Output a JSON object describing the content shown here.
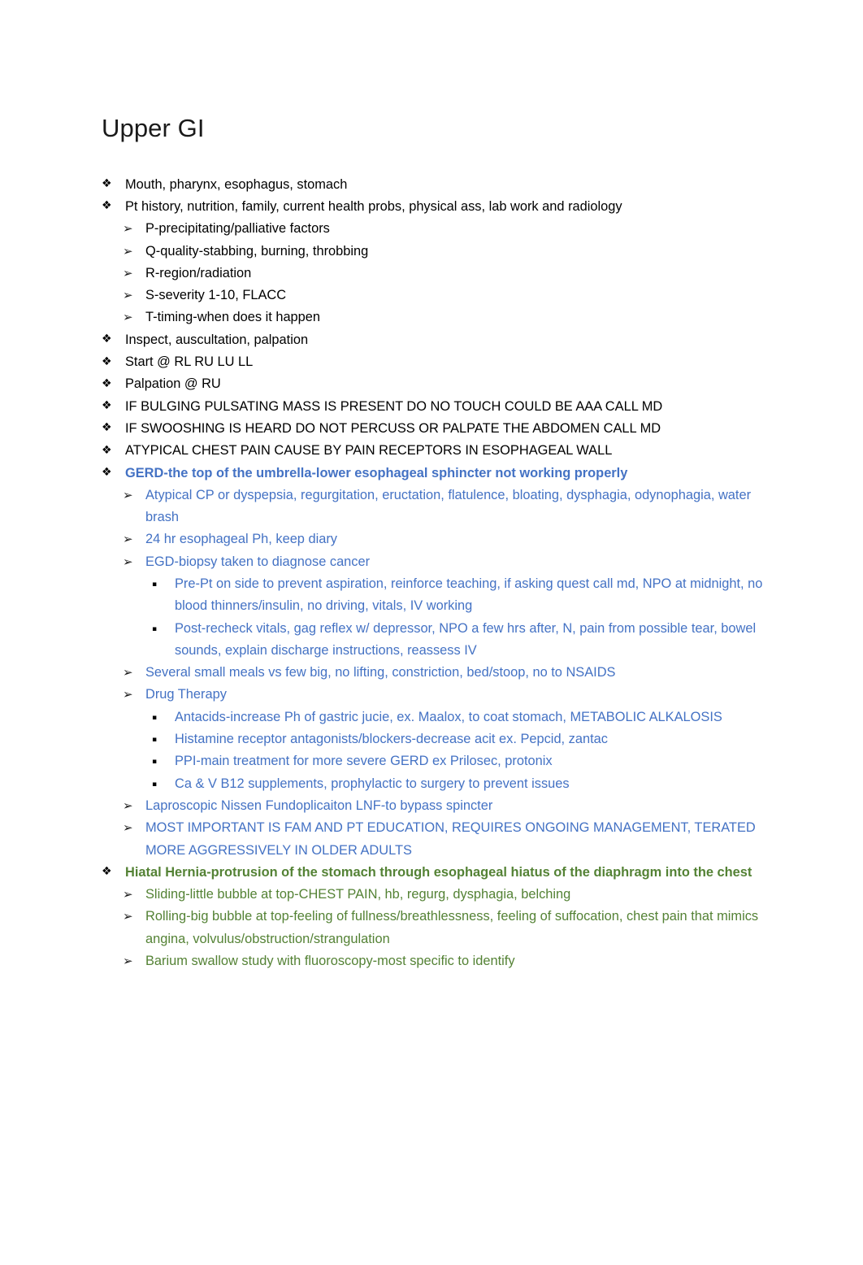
{
  "document": {
    "title": "Upper GI",
    "colors": {
      "text_black": "#000000",
      "accent_blue": "#4472C4",
      "accent_green": "#548235",
      "background": "#ffffff"
    },
    "bullets": {
      "level1": "❖",
      "level2": "➢",
      "level3": "▪"
    }
  },
  "outline": {
    "items": [
      {
        "text": "Mouth, pharynx, esophagus, stomach"
      },
      {
        "text": "Pt history, nutrition, family, current health probs, physical ass, lab work and radiology"
      },
      {
        "text": "P-precipitating/palliative factors"
      },
      {
        "text": "Q-quality-stabbing, burning, throbbing"
      },
      {
        "text": "R-region/radiation"
      },
      {
        "text": "S-severity 1-10, FLACC"
      },
      {
        "text": "T-timing-when does it happen"
      },
      {
        "text": "Inspect, auscultation, palpation"
      },
      {
        "text": "Start @ RL RU LU LL"
      },
      {
        "text": "Palpation @ RU"
      },
      {
        "text": "IF BULGING PULSATING MASS IS PRESENT DO NO TOUCH COULD BE AAA CALL MD"
      },
      {
        "text": "IF SWOOSHING IS HEARD DO NOT PERCUSS OR PALPATE THE ABDOMEN CALL MD"
      },
      {
        "text": "ATYPICAL CHEST PAIN CAUSE BY PAIN RECEPTORS IN ESOPHAGEAL WALL"
      },
      {
        "text": "GERD-the top of the umbrella-lower esophageal sphincter not working properly"
      },
      {
        "text": "Atypical CP or dyspepsia, regurgitation, eructation, flatulence, bloating, dysphagia, odynophagia, water brash"
      },
      {
        "text": "24 hr esophageal Ph, keep diary"
      },
      {
        "text": "EGD-biopsy taken to diagnose cancer"
      },
      {
        "text": "Pre-Pt on side to prevent aspiration, reinforce teaching, if asking quest call md, NPO at midnight, no blood thinners/insulin, no driving, vitals, IV working"
      },
      {
        "text": "Post-recheck vitals, gag reflex w/ depressor, NPO a few hrs after, N, pain from possible tear, bowel sounds, explain discharge instructions, reassess IV"
      },
      {
        "text": "Several small meals vs few big, no lifting, constriction, bed/stoop, no to NSAIDS"
      },
      {
        "text": "Drug Therapy"
      },
      {
        "text": "Antacids-increase Ph of gastric jucie, ex. Maalox, to coat stomach, METABOLIC ALKALOSIS"
      },
      {
        "text": "Histamine receptor antagonists/blockers-decrease acit ex. Pepcid, zantac"
      },
      {
        "text": "PPI-main treatment for more severe GERD ex Prilosec, protonix"
      },
      {
        "text": "Ca & V B12 supplements, prophylactic to surgery to prevent issues"
      },
      {
        "text": "Laproscopic Nissen Fundoplicaiton LNF-to bypass spincter"
      },
      {
        "text": "MOST IMPORTANT IS FAM AND PT EDUCATION, REQUIRES ONGOING MANAGEMENT, TERATED MORE AGGRESSIVELY IN OLDER ADULTS"
      },
      {
        "text": "Hiatal Hernia-protrusion of the stomach through esophageal hiatus of the diaphragm into the chest"
      },
      {
        "text": "Sliding-little bubble at top-CHEST PAIN, hb, regurg, dysphagia, belching"
      },
      {
        "text": "Rolling-big bubble at top-feeling of fullness/breathlessness, feeling of suffocation, chest pain that mimics angina, volvulus/obstruction/strangulation"
      },
      {
        "text": "Barium swallow study with fluoroscopy-most specific to identify"
      }
    ]
  }
}
